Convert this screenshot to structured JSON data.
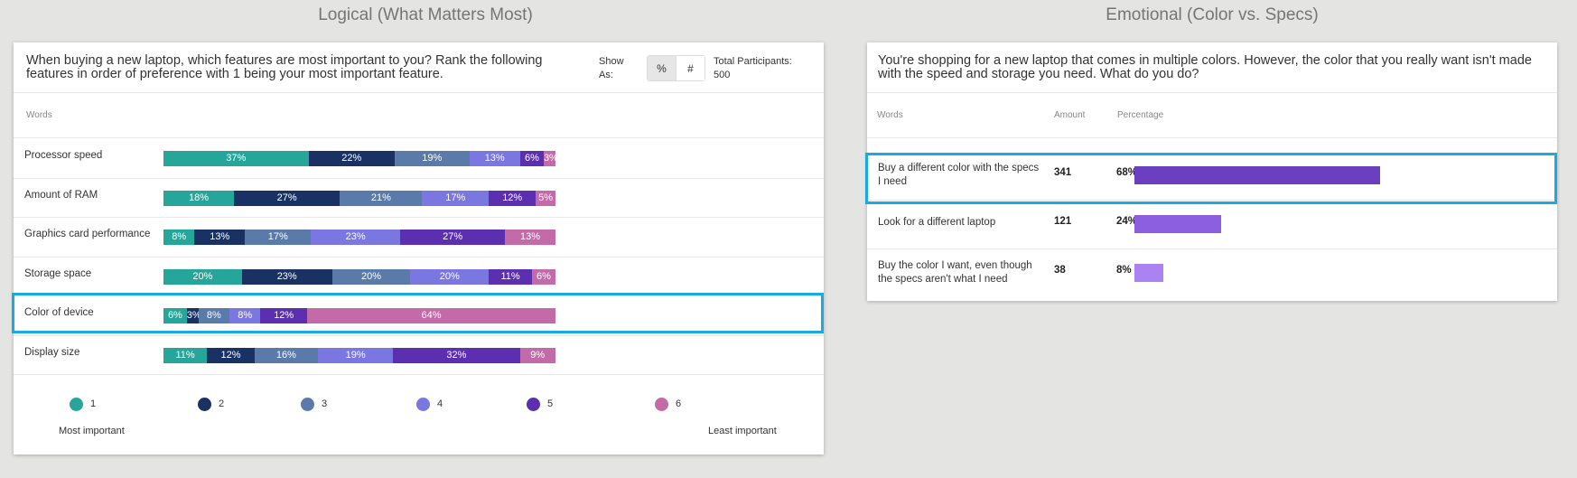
{
  "left_title": "Logical (What Matters Most)",
  "right_title": "Emotional (Color vs. Specs)",
  "left_card": {
    "question": "When buying a new laptop, which features are most important to you? Rank the following features in order of preference with 1 being your most important feature.",
    "show_as_label": "Show As:",
    "toggle_percent": "%",
    "toggle_count": "#",
    "participants_label": "Total Participants:",
    "participants_value": "500",
    "words_header": "Words",
    "legend_most": "Most important",
    "legend_least": "Least important",
    "highlighted_row": "Color of device"
  },
  "right_card": {
    "question": "You're shopping for a new laptop that comes in multiple colors. However, the color that you really want isn't made with the speed and storage you need. What do you do?",
    "words_header": "Words",
    "amount_header": "Amount",
    "percentage_header": "Percentage",
    "highlighted_row": "Buy a different color with the specs I need"
  },
  "colors": {
    "rank1": "#26a69a",
    "rank2": "#1a3263",
    "rank3": "#5a7baa",
    "rank4": "#7b77e0",
    "rank5": "#5c2fb0",
    "rank6": "#c36aa8",
    "highlight": "#1aa9e1",
    "right_bar1": "#6a3fc0",
    "right_bar2": "#8c5fe0",
    "right_bar3": "#ab82f2"
  },
  "chart_data": [
    {
      "type": "bar",
      "stacked": true,
      "orientation": "horizontal",
      "categories": [
        "Processor speed",
        "Amount of RAM",
        "Graphics card performance",
        "Storage space",
        "Color of device",
        "Display size"
      ],
      "series": [
        {
          "name": "1",
          "values": [
            37,
            18,
            8,
            20,
            6,
            11
          ]
        },
        {
          "name": "2",
          "values": [
            22,
            27,
            13,
            23,
            3,
            12
          ]
        },
        {
          "name": "3",
          "values": [
            19,
            21,
            17,
            20,
            8,
            16
          ]
        },
        {
          "name": "4",
          "values": [
            13,
            17,
            23,
            20,
            8,
            19
          ]
        },
        {
          "name": "5",
          "values": [
            6,
            12,
            27,
            11,
            12,
            32
          ]
        },
        {
          "name": "6",
          "values": [
            3,
            5,
            13,
            6,
            64,
            9
          ]
        }
      ],
      "value_suffix": "%",
      "legend": [
        "1",
        "2",
        "3",
        "4",
        "5",
        "6"
      ],
      "legend_placement": "bottom"
    },
    {
      "type": "bar",
      "orientation": "horizontal",
      "categories": [
        "Buy a different color with the specs I need",
        "Look for a different laptop",
        "Buy the color I want, even though the specs aren't what I need"
      ],
      "amounts": [
        341,
        121,
        38
      ],
      "percentages": [
        68,
        24,
        8
      ],
      "value_suffix": "%"
    }
  ]
}
